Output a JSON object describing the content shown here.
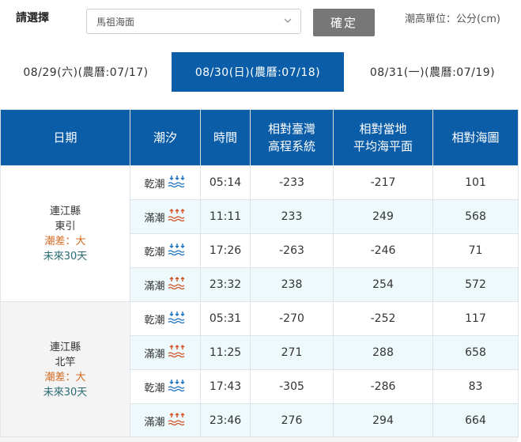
{
  "controls": {
    "select_label": "請選擇",
    "select_value": "馬祖海面",
    "confirm_label": "確定",
    "unit_note": "潮高單位：公分(cm)"
  },
  "tabs": [
    {
      "label": "08/29(六)(農曆:07/17)",
      "active": false
    },
    {
      "label": "08/30(日)(農曆:07/18)",
      "active": true
    },
    {
      "label": "08/31(一)(農曆:07/19)",
      "active": false
    }
  ],
  "table": {
    "headers": {
      "date": "日期",
      "tide": "潮汐",
      "time": "時間",
      "twvd_line1": "相對臺灣",
      "twvd_line2": "高程系統",
      "local_line1": "相對當地",
      "local_line2": "平均海平面",
      "chart": "相對海圖"
    },
    "stations": [
      {
        "county": "連江縣",
        "name": "東引",
        "diff": "潮差：大",
        "link": "未來30天",
        "rows": [
          {
            "tide": "乾潮",
            "type": "low",
            "time": "05:14",
            "twvd": "-233",
            "local": "-217",
            "chart": "101"
          },
          {
            "tide": "滿潮",
            "type": "high",
            "time": "11:11",
            "twvd": "233",
            "local": "249",
            "chart": "568"
          },
          {
            "tide": "乾潮",
            "type": "low",
            "time": "17:26",
            "twvd": "-263",
            "local": "-246",
            "chart": "71"
          },
          {
            "tide": "滿潮",
            "type": "high",
            "time": "23:32",
            "twvd": "238",
            "local": "254",
            "chart": "572"
          }
        ]
      },
      {
        "county": "連江縣",
        "name": "北竿",
        "diff": "潮差：大",
        "link": "未來30天",
        "rows": [
          {
            "tide": "乾潮",
            "type": "low",
            "time": "05:31",
            "twvd": "-270",
            "local": "-252",
            "chart": "117"
          },
          {
            "tide": "滿潮",
            "type": "high",
            "time": "11:25",
            "twvd": "271",
            "local": "288",
            "chart": "658"
          },
          {
            "tide": "乾潮",
            "type": "low",
            "time": "17:43",
            "twvd": "-305",
            "local": "-286",
            "chart": "83"
          },
          {
            "tide": "滿潮",
            "type": "high",
            "time": "23:46",
            "twvd": "276",
            "local": "294",
            "chart": "664"
          }
        ]
      }
    ]
  },
  "colors": {
    "accent": "#0b5da8",
    "low_tide_icon": "#1e73be",
    "high_tide_icon": "#d2542a",
    "tide_diff": "#d2691e"
  },
  "icons": {
    "select_arrow": "chevron-down-icon",
    "low_tide": "low-tide-icon",
    "high_tide": "high-tide-icon"
  }
}
